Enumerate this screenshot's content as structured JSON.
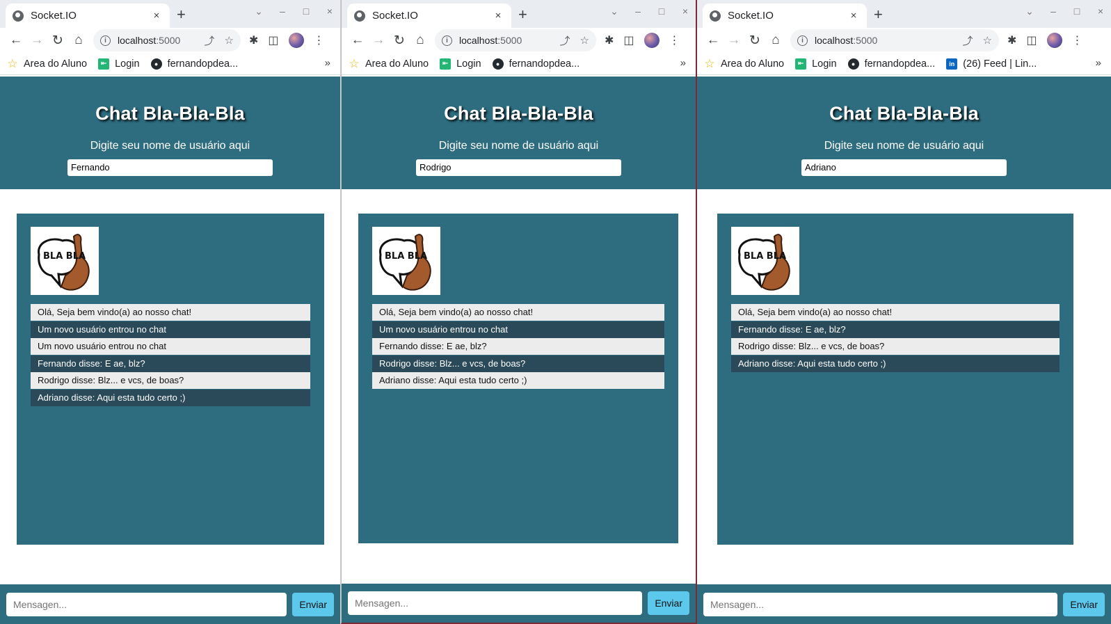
{
  "browser": {
    "tab_title": "Socket.IO",
    "tab_close": "×",
    "new_tab": "+",
    "window_controls": {
      "chevron": "⌄",
      "minimize": "–",
      "maximize": "□",
      "close": "×"
    },
    "url_host": "localhost",
    "url_port": ":5000",
    "bookmarks": [
      "Area do Aluno",
      "Login",
      "fernandopdea...",
      "(26) Feed | Lin..."
    ],
    "bookmarks_more": "»"
  },
  "chat": {
    "title": "Chat Bla-Bla-Bla",
    "username_prompt": "Digite seu nome de usuário aqui",
    "logo_text": "BLA BLA",
    "message_placeholder": "Mensagen...",
    "send_label": "Enviar"
  },
  "windows": [
    {
      "username": "Fernando",
      "messages": [
        "Olá, Seja bem vindo(a) ao nosso chat!",
        "Um novo usuário entrou no chat",
        "Um novo usuário entrou no chat",
        "Fernando disse: E ae, blz?",
        "Rodrigo disse: Blz... e vcs, de boas?",
        "Adriano disse: Aqui esta tudo certo ;)"
      ]
    },
    {
      "username": "Rodrigo",
      "messages": [
        "Olá, Seja bem vindo(a) ao nosso chat!",
        "Um novo usuário entrou no chat",
        "Fernando disse: E ae, blz?",
        "Rodrigo disse: Blz... e vcs, de boas?",
        "Adriano disse: Aqui esta tudo certo ;)"
      ]
    },
    {
      "username": "Adriano",
      "messages": [
        "Olá, Seja bem vindo(a) ao nosso chat!",
        "Fernando disse: E ae, blz?",
        "Rodrigo disse: Blz... e vcs, de boas?",
        "Adriano disse: Aqui esta tudo certo ;)"
      ]
    }
  ]
}
